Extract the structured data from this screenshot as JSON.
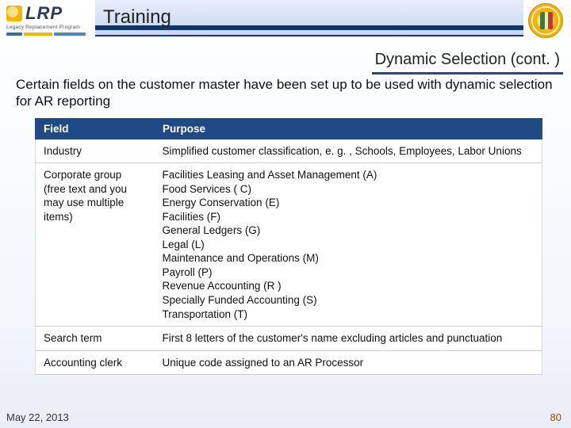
{
  "header": {
    "logo_text": "LRP",
    "logo_sub": "Legacy Replacement Program",
    "title": "Training"
  },
  "subtitle": "Dynamic Selection (cont. )",
  "intro": "Certain fields on the customer master have been set up to be used with dynamic selection for AR reporting",
  "table": {
    "headers": {
      "field": "Field",
      "purpose": "Purpose"
    },
    "rows": [
      {
        "field": "Industry",
        "purpose": "Simplified customer classification, e. g. , Schools, Employees, Labor Unions"
      },
      {
        "field": "Corporate group (free text and you may use multiple items)",
        "purpose": "Facilities Leasing and Asset Management (A)\nFood Services ( C)\nEnergy Conservation (E)\nFacilities (F)\nGeneral Ledgers (G)\nLegal (L)\nMaintenance and Operations (M)\nPayroll (P)\nRevenue Accounting (R )\nSpecially Funded Accounting (S)\nTransportation (T)"
      },
      {
        "field": "Search term",
        "purpose": "First 8 letters of the customer's name excluding articles and punctuation"
      },
      {
        "field": "Accounting clerk",
        "purpose": "Unique code assigned to an AR Processor"
      }
    ]
  },
  "footer": {
    "date": "May 22, 2013",
    "page": "80"
  }
}
